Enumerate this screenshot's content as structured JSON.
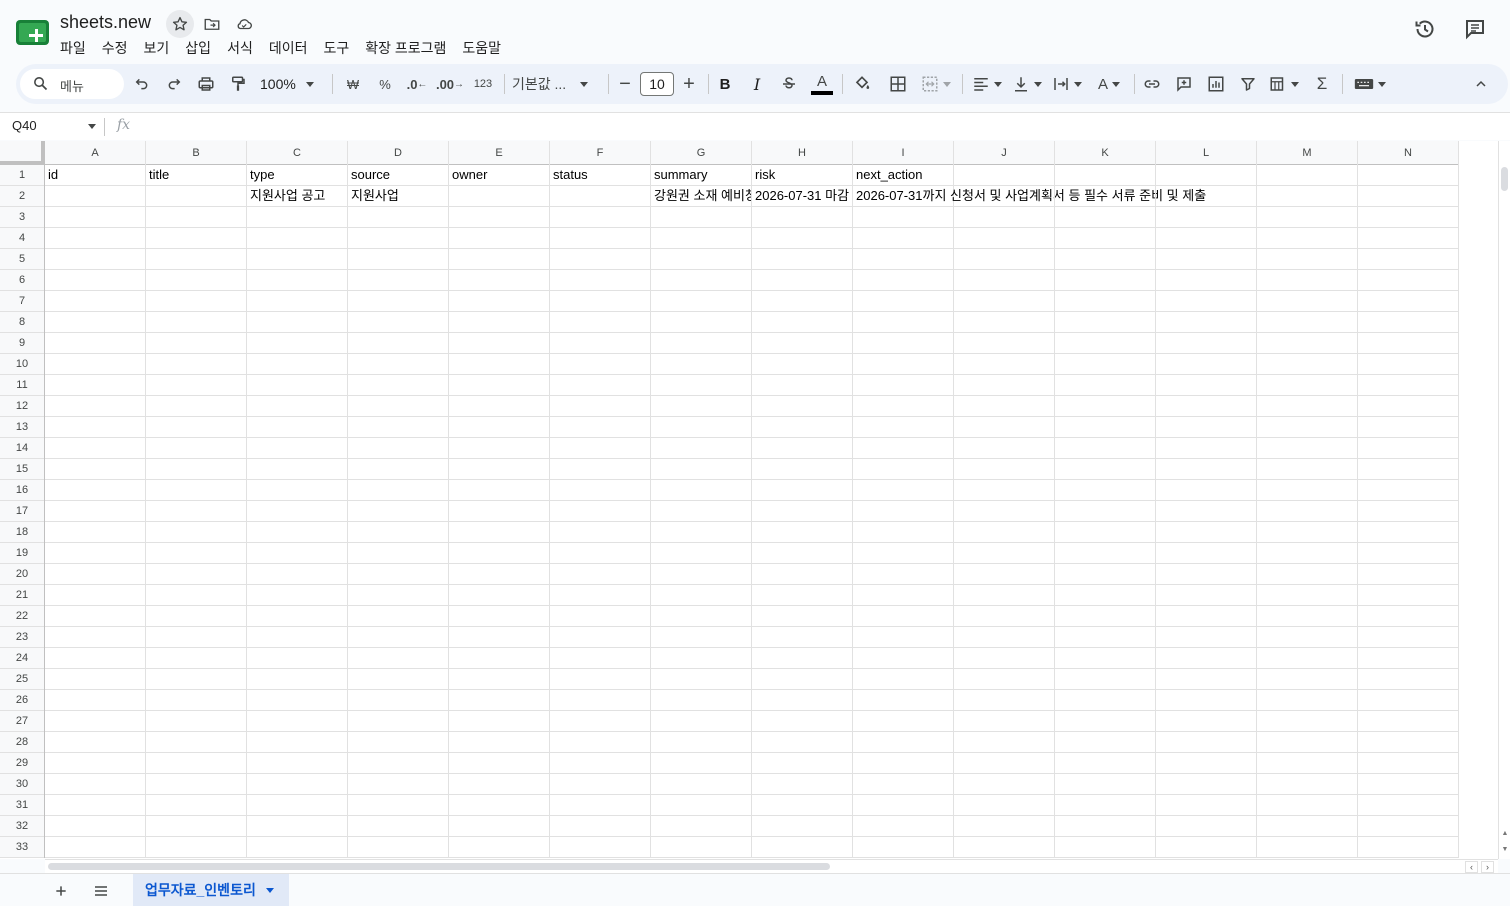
{
  "app": {
    "title": "sheets.new",
    "menu": [
      "파일",
      "수정",
      "보기",
      "삽입",
      "서식",
      "데이터",
      "도구",
      "확장 프로그램",
      "도움말"
    ]
  },
  "toolbar": {
    "search_label": "메뉴",
    "zoom": "100%",
    "currency": "₩",
    "percent": "%",
    "decimal_decrease": ".0",
    "decimal_increase": ".00",
    "number_format": "123",
    "font_family": "기본값 ...",
    "font_size": "10"
  },
  "formula_bar": {
    "cell_ref": "Q40",
    "fx": "fx",
    "value": ""
  },
  "grid": {
    "columns": [
      "A",
      "B",
      "C",
      "D",
      "E",
      "F",
      "G",
      "H",
      "I",
      "J",
      "K",
      "L",
      "M",
      "N"
    ],
    "row_count": 33,
    "rows": [
      [
        "id",
        "title",
        "type",
        "source",
        "owner",
        "status",
        "summary",
        "risk",
        "next_action",
        "",
        "",
        "",
        "",
        ""
      ],
      [
        "",
        "",
        "지원사업 공고",
        "지원사업",
        "",
        "",
        "강원권 소재 예비창업자 대상 지원사업",
        "2026-07-31 마감",
        "2026-07-31까지 신청서 및 사업계획서 등 필수 서류 준비 및 제출",
        "",
        "",
        "",
        "",
        ""
      ]
    ]
  },
  "sheets": {
    "active": "업무자료_인벤토리"
  }
}
